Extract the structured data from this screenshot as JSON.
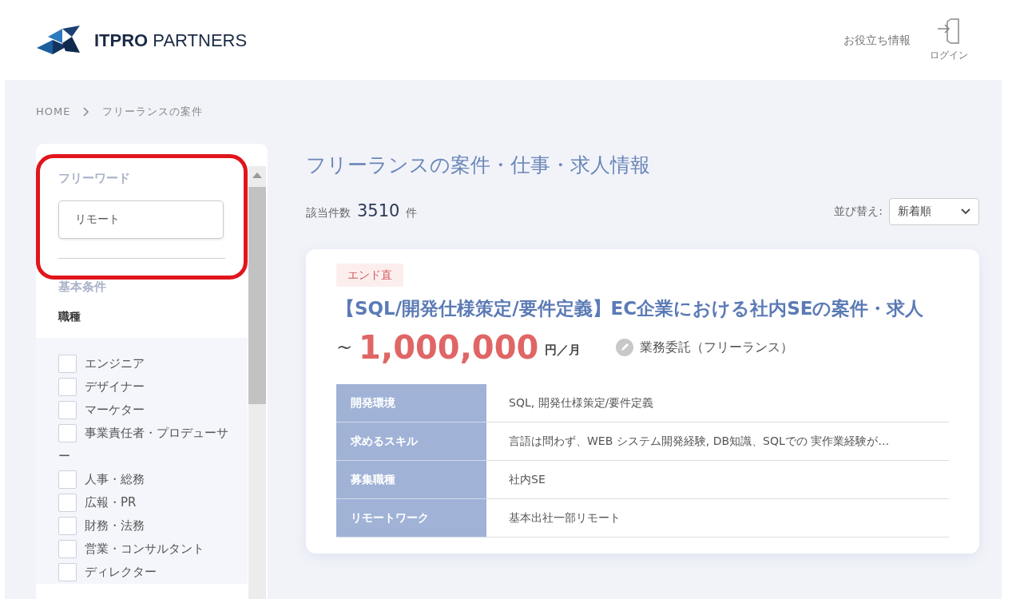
{
  "header": {
    "logo_text": "**ITPRO** PARTNERS",
    "nav": [
      {
        "label": "お役立ち情報"
      }
    ],
    "login": "ログイン"
  },
  "breadcrumb": [
    "HOME",
    "フリーランスの案件"
  ],
  "sidebar": {
    "freeword": {
      "label": "フリーワード",
      "value": "リモート"
    },
    "section_title": "基本条件",
    "group_title": "職種",
    "options": [
      {
        "label": "エンジニア",
        "checked": false
      },
      {
        "label": "デザイナー",
        "checked": false
      },
      {
        "label": "マーケター",
        "checked": false
      },
      {
        "label": "事業責任者・プロデューサー",
        "checked": false
      },
      {
        "label": "人事・総務",
        "checked": false
      },
      {
        "label": "広報・PR",
        "checked": false
      },
      {
        "label": "財務・法務",
        "checked": false
      },
      {
        "label": "営業・コンサルタント",
        "checked": false
      },
      {
        "label": "ディレクター",
        "checked": false
      }
    ]
  },
  "main": {
    "title": "フリーランスの案件・仕事・求人情報",
    "count_label": "該当件数",
    "count": "3510",
    "count_unit": "件",
    "sort_label": "並び替え:",
    "sort_value": "新着順",
    "job": {
      "tag": "エンド直",
      "title": "【SQL/開発仕様策定/要件定義】EC企業における社内SEの案件・求人",
      "price_prefix": "~",
      "price": "1,000,000",
      "price_unit": "円／月",
      "contract": "業務委託（フリーランス）",
      "details": [
        {
          "label": "開発環境",
          "value": "SQL, 開発仕様策定/要件定義"
        },
        {
          "label": "求めるスキル",
          "value": "言語は問わず、WEB システム開発経験, DB知識、SQLでの 実作業経験が…"
        },
        {
          "label": "募集職種",
          "value": "社内SE"
        },
        {
          "label": "リモートワーク",
          "value": "基本出社一部リモート"
        }
      ]
    }
  }
}
